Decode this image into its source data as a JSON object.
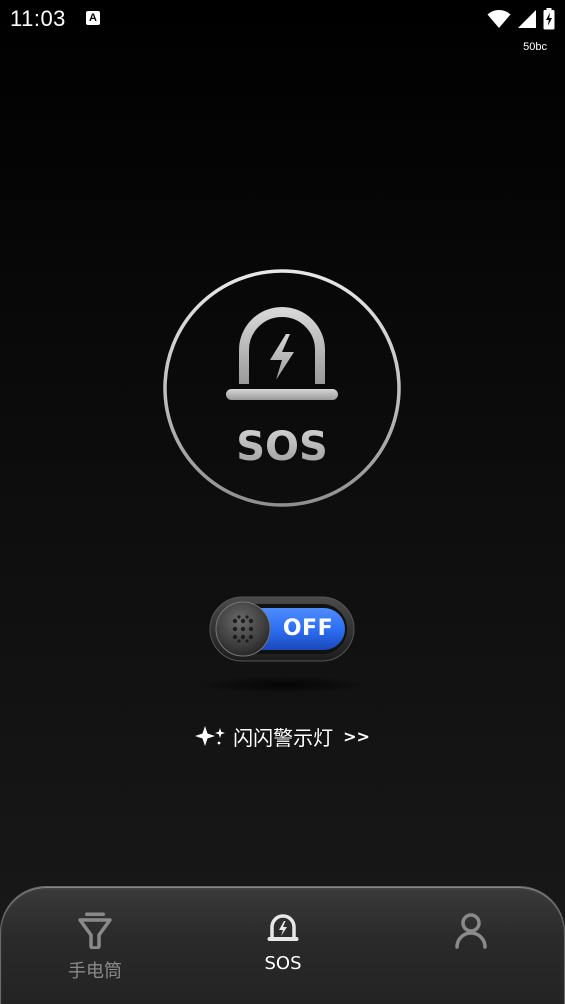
{
  "status_bar": {
    "time": "11:03",
    "notification_icon": "a-letter-icon",
    "notification_letter": "A",
    "wifi_icon": "wifi-icon",
    "signal_icon": "cell-signal-icon",
    "battery_icon": "battery-charging-icon",
    "sub_label": "50bc"
  },
  "main": {
    "sos_icon": "siren-icon",
    "sos_label": "SOS",
    "toggle": {
      "state_label": "OFF",
      "accent_color": "#2b6cf0"
    },
    "flash_link": {
      "icon": "sparkle-icon",
      "label": "闪闪警示灯",
      "arrow": ">>"
    }
  },
  "bottom_nav": {
    "items": [
      {
        "label": "手电筒",
        "icon": "flashlight-icon",
        "active": false
      },
      {
        "label": "SOS",
        "icon": "siren-icon",
        "active": true
      },
      {
        "label": "",
        "icon": "person-icon",
        "active": false
      }
    ],
    "active_color": "#ffffff",
    "inactive_color": "#8a8a8a"
  }
}
